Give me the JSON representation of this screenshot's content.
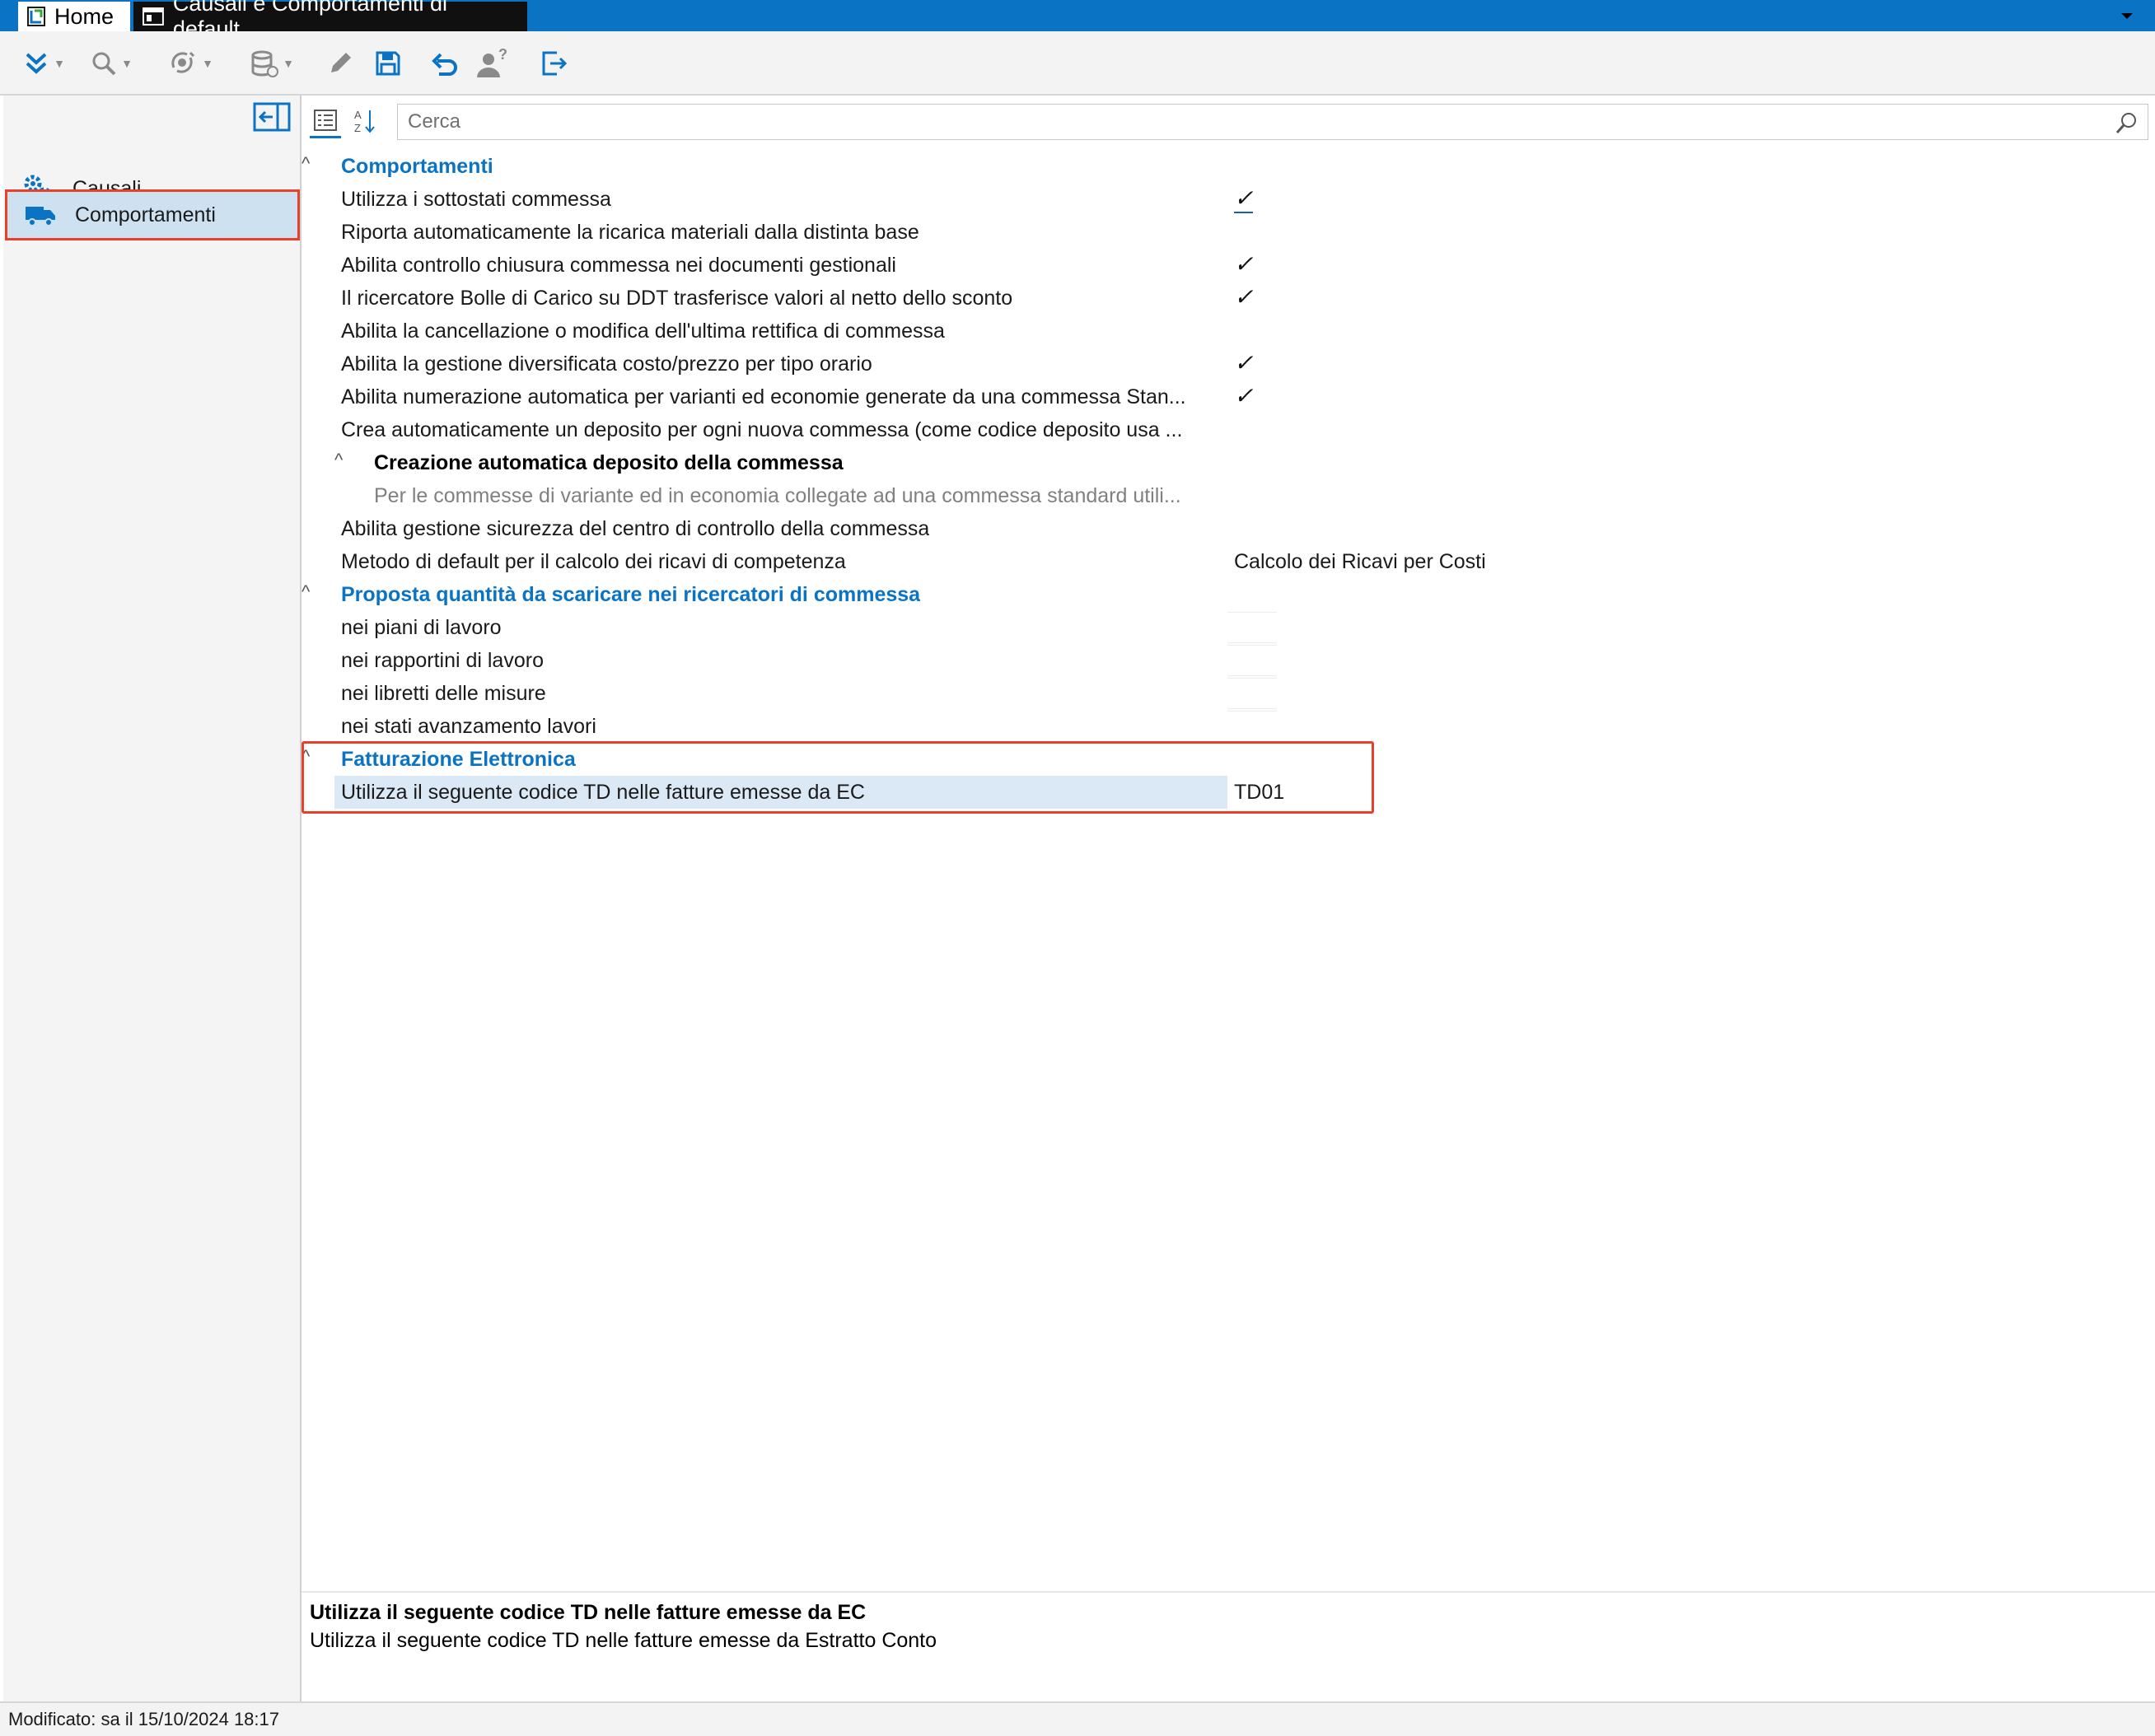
{
  "titlebar": {
    "home_tab": "Home",
    "doc_tab": "Causali e Comportamenti di default"
  },
  "toolbar": {
    "buttons": [
      "expand-icon",
      "search-icon",
      "filter-icon",
      "database-icon",
      "edit-icon",
      "save-icon",
      "undo-icon",
      "user-help-icon",
      "exit-icon"
    ]
  },
  "sidebar": {
    "items": [
      {
        "label": "Causali",
        "icon": "gears-icon"
      },
      {
        "label": "Comportamenti",
        "icon": "truck-icon",
        "selected": true
      }
    ]
  },
  "search": {
    "placeholder": "Cerca"
  },
  "properties": {
    "cat1": "Comportamenti",
    "rows1": [
      {
        "label": "Utilizza i sottostati commessa",
        "value": "✓"
      },
      {
        "label": "Riporta automaticamente la ricarica materiali dalla distinta base",
        "value": ""
      },
      {
        "label": "Abilita controllo chiusura commessa nei documenti gestionali",
        "value": "✓"
      },
      {
        "label": "Il ricercatore Bolle di Carico su DDT trasferisce valori al netto dello sconto",
        "value": "✓"
      },
      {
        "label": "Abilita la cancellazione o modifica dell'ultima rettifica di commessa",
        "value": ""
      },
      {
        "label": "Abilita la gestione diversificata costo/prezzo per tipo orario",
        "value": "✓"
      },
      {
        "label": "Abilita numerazione automatica per varianti ed economie generate da una commessa Stan...",
        "value": "✓"
      },
      {
        "label": "Crea automaticamente un deposito per ogni nuova commessa (come codice deposito usa ...",
        "value": ""
      }
    ],
    "sub1": "Creazione automatica deposito della commessa",
    "sub1_desc": "Per le commesse di variante ed in economia collegate ad una commessa standard utili...",
    "rows1b": [
      {
        "label": "Abilita gestione sicurezza del centro di controllo della commessa",
        "value": ""
      },
      {
        "label": "Metodo di default per il calcolo dei ricavi di competenza",
        "value": "Calcolo dei Ricavi per Costi"
      }
    ],
    "cat2": "Proposta quantità da scaricare nei ricercatori di commessa",
    "rows2": [
      {
        "label": "nei piani di lavoro"
      },
      {
        "label": "nei rapportini di lavoro"
      },
      {
        "label": "nei libretti delle misure"
      },
      {
        "label": "nei stati avanzamento lavori"
      }
    ],
    "cat3": "Fatturazione Elettronica",
    "rows3": [
      {
        "label": "Utilizza il seguente codice TD nelle fatture emesse da EC",
        "value": "TD01"
      }
    ]
  },
  "description": {
    "title": "Utilizza il seguente codice TD nelle fatture emesse da EC",
    "text": "Utilizza il seguente codice TD nelle fatture emesse da Estratto Conto"
  },
  "status": {
    "text": "Modificato: sa il 15/10/2024 18:17"
  },
  "colors": {
    "accent": "#0b73c4",
    "highlight": "#e8412a",
    "selected_bg": "#cde1f1"
  }
}
